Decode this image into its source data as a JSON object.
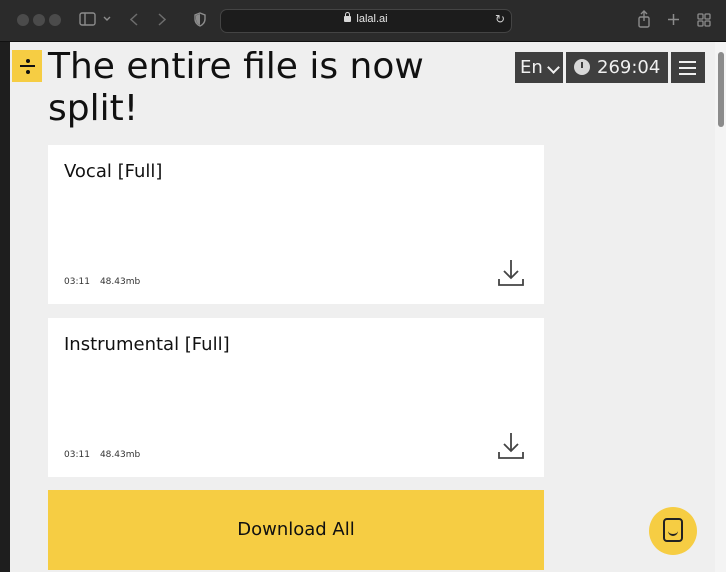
{
  "browser": {
    "url": "lalal.ai"
  },
  "header": {
    "title": "The entire file is now split!",
    "language": "En",
    "credits": "269:04"
  },
  "tracks": [
    {
      "name": "Vocal [Full]",
      "duration": "03:11",
      "size": "48.43mb"
    },
    {
      "name": "Instrumental [Full]",
      "duration": "03:11",
      "size": "48.43mb"
    }
  ],
  "actions": {
    "download_all": "Download All"
  },
  "colors": {
    "accent": "#f6cd43",
    "dark_button": "#3f3f3f",
    "page_bg": "#efefef"
  },
  "icons": {
    "logo": "divide-icon",
    "credits": "clock-icon",
    "menu": "hamburger-icon",
    "download": "download-icon",
    "chat": "chat-icon"
  }
}
